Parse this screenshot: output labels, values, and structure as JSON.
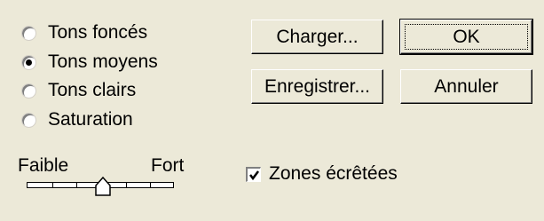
{
  "tone_options": {
    "items": [
      {
        "label": "Tons foncés",
        "checked": false
      },
      {
        "label": "Tons moyens",
        "checked": true
      },
      {
        "label": "Tons clairs",
        "checked": false
      },
      {
        "label": "Saturation",
        "checked": false
      }
    ]
  },
  "strength_slider": {
    "min_label": "Faible",
    "max_label": "Fort",
    "steps": 6,
    "value": 3
  },
  "buttons": {
    "load": "Charger...",
    "ok": "OK",
    "save": "Enregistrer...",
    "cancel": "Annuler"
  },
  "clipping_checkbox": {
    "label": "Zones écrêtées",
    "checked": true
  }
}
